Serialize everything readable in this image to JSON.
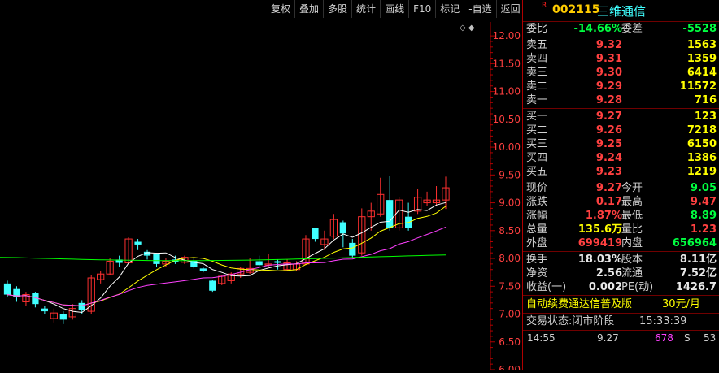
{
  "toolbar": [
    "复权",
    "叠加",
    "多股",
    "统计",
    "画线",
    "F10",
    "标记",
    "-自选",
    "返回"
  ],
  "chart": {
    "y_ticks": [
      "12.00",
      "11.50",
      "11.00",
      "10.50",
      "10.00",
      "9.50",
      "9.00",
      "8.50",
      "8.00",
      "7.50",
      "7.00",
      "6.50",
      "6.00"
    ],
    "toggle_icon": "◇ ◆",
    "candle_up_color": "#ff3030",
    "candle_down_color": "#40ffff",
    "ma_colors": [
      "#ffffff",
      "#ffff00",
      "#ff40ff",
      "#00ff00"
    ]
  },
  "chart_data": {
    "type": "candlestick",
    "ylim": [
      6.0,
      12.25
    ],
    "ma_periods": [
      5,
      10,
      20,
      60
    ],
    "candles": [
      {
        "o": 7.55,
        "c": 7.35,
        "h": 7.6,
        "l": 7.3
      },
      {
        "o": 7.45,
        "c": 7.3,
        "h": 7.5,
        "l": 7.22
      },
      {
        "o": 7.22,
        "c": 7.35,
        "h": 7.4,
        "l": 7.15
      },
      {
        "o": 7.38,
        "c": 7.18,
        "h": 7.4,
        "l": 7.12
      },
      {
        "o": 7.1,
        "c": 7.05,
        "h": 7.15,
        "l": 7.0
      },
      {
        "o": 6.92,
        "c": 7.02,
        "h": 7.1,
        "l": 6.85
      },
      {
        "o": 7.0,
        "c": 6.9,
        "h": 7.05,
        "l": 6.82
      },
      {
        "o": 6.95,
        "c": 7.1,
        "h": 7.18,
        "l": 6.9
      },
      {
        "o": 7.2,
        "c": 7.08,
        "h": 7.25,
        "l": 7.0
      },
      {
        "o": 7.05,
        "c": 7.65,
        "h": 7.7,
        "l": 7.0
      },
      {
        "o": 7.62,
        "c": 7.72,
        "h": 7.78,
        "l": 7.55
      },
      {
        "o": 7.72,
        "c": 7.95,
        "h": 8.0,
        "l": 7.7
      },
      {
        "o": 7.98,
        "c": 7.92,
        "h": 8.05,
        "l": 7.85
      },
      {
        "o": 7.92,
        "c": 8.35,
        "h": 8.38,
        "l": 7.9
      },
      {
        "o": 8.3,
        "c": 8.25,
        "h": 8.35,
        "l": 8.15
      },
      {
        "o": 8.12,
        "c": 8.05,
        "h": 8.15,
        "l": 7.98
      },
      {
        "o": 8.08,
        "c": 7.9,
        "h": 8.1,
        "l": 7.85
      },
      {
        "o": 7.9,
        "c": 7.95,
        "h": 8.0,
        "l": 7.85
      },
      {
        "o": 7.98,
        "c": 7.93,
        "h": 8.05,
        "l": 7.9
      },
      {
        "o": 7.93,
        "c": 8.02,
        "h": 8.05,
        "l": 7.9
      },
      {
        "o": 7.96,
        "c": 7.85,
        "h": 8.0,
        "l": 7.82
      },
      {
        "o": 7.82,
        "c": 7.78,
        "h": 7.85,
        "l": 7.75
      },
      {
        "o": 7.6,
        "c": 7.42,
        "h": 7.62,
        "l": 7.4
      },
      {
        "o": 7.55,
        "c": 7.68,
        "h": 7.7,
        "l": 7.52
      },
      {
        "o": 7.6,
        "c": 7.72,
        "h": 7.75,
        "l": 7.55
      },
      {
        "o": 7.72,
        "c": 7.82,
        "h": 7.85,
        "l": 7.65
      },
      {
        "o": 7.75,
        "c": 7.82,
        "h": 8.0,
        "l": 7.72
      },
      {
        "o": 7.95,
        "c": 7.88,
        "h": 8.05,
        "l": 7.85
      },
      {
        "o": 7.88,
        "c": 7.9,
        "h": 8.08,
        "l": 7.85
      },
      {
        "o": 7.95,
        "c": 7.92,
        "h": 7.98,
        "l": 7.8
      },
      {
        "o": 7.8,
        "c": 7.92,
        "h": 7.98,
        "l": 7.78
      },
      {
        "o": 7.8,
        "c": 7.9,
        "h": 7.95,
        "l": 7.78
      },
      {
        "o": 7.9,
        "c": 8.35,
        "h": 8.42,
        "l": 7.88
      },
      {
        "o": 8.55,
        "c": 8.35,
        "h": 8.55,
        "l": 8.3
      },
      {
        "o": 8.25,
        "c": 8.35,
        "h": 8.5,
        "l": 8.15
      },
      {
        "o": 8.4,
        "c": 8.7,
        "h": 8.8,
        "l": 8.35
      },
      {
        "o": 8.65,
        "c": 8.45,
        "h": 8.68,
        "l": 8.2
      },
      {
        "o": 8.28,
        "c": 8.05,
        "h": 8.35,
        "l": 8.0
      },
      {
        "o": 8.1,
        "c": 8.75,
        "h": 8.9,
        "l": 8.05
      },
      {
        "o": 8.75,
        "c": 8.85,
        "h": 9.0,
        "l": 8.5
      },
      {
        "o": 8.8,
        "c": 9.15,
        "h": 9.45,
        "l": 8.75
      },
      {
        "o": 9.05,
        "c": 8.55,
        "h": 9.48,
        "l": 8.5
      },
      {
        "o": 8.55,
        "c": 9.05,
        "h": 9.1,
        "l": 8.5
      },
      {
        "o": 8.75,
        "c": 8.55,
        "h": 9.0,
        "l": 8.5
      },
      {
        "o": 8.85,
        "c": 9.1,
        "h": 9.25,
        "l": 8.8
      },
      {
        "o": 9.0,
        "c": 9.05,
        "h": 9.2,
        "l": 8.95
      },
      {
        "o": 9.0,
        "c": 9.05,
        "h": 9.3,
        "l": 8.95
      },
      {
        "o": 9.05,
        "c": 9.27,
        "h": 9.47,
        "l": 8.89
      }
    ]
  },
  "quote": {
    "rmark": "R",
    "code": "002115",
    "name": "三维通信",
    "wei_label": "委比",
    "wei_value": "-14.66%",
    "weicha_label": "委差",
    "weicha_value": "-5528",
    "sell": [
      {
        "label": "卖五",
        "price": "9.32",
        "vol": "1563"
      },
      {
        "label": "卖四",
        "price": "9.31",
        "vol": "1359"
      },
      {
        "label": "卖三",
        "price": "9.30",
        "vol": "6414"
      },
      {
        "label": "卖二",
        "price": "9.29",
        "vol": "11572"
      },
      {
        "label": "卖一",
        "price": "9.28",
        "vol": "716"
      }
    ],
    "buy": [
      {
        "label": "买一",
        "price": "9.27",
        "vol": "123"
      },
      {
        "label": "买二",
        "price": "9.26",
        "vol": "7218"
      },
      {
        "label": "买三",
        "price": "9.25",
        "vol": "6150"
      },
      {
        "label": "买四",
        "price": "9.24",
        "vol": "1386"
      },
      {
        "label": "买五",
        "price": "9.23",
        "vol": "1219"
      }
    ],
    "stats": [
      {
        "l1": "现价",
        "v1": "9.27",
        "c1": "red",
        "l2": "今开",
        "v2": "9.05",
        "c2": "green"
      },
      {
        "l1": "涨跌",
        "v1": "0.17",
        "c1": "red",
        "l2": "最高",
        "v2": "9.47",
        "c2": "red"
      },
      {
        "l1": "涨幅",
        "v1": "1.87%",
        "c1": "red",
        "l2": "最低",
        "v2": "8.89",
        "c2": "green"
      },
      {
        "l1": "总量",
        "v1": "135.6万",
        "c1": "yellow",
        "l2": "量比",
        "v2": "1.23",
        "c2": "red"
      },
      {
        "l1": "外盘",
        "v1": "699419",
        "c1": "red",
        "l2": "内盘",
        "v2": "656964",
        "c2": "green"
      }
    ],
    "fund": [
      {
        "l1": "换手",
        "v1": "18.03%",
        "l2": "股本",
        "v2": "8.11亿"
      },
      {
        "l1": "净资",
        "v1": "2.56",
        "l2": "流通",
        "v2": "7.52亿"
      },
      {
        "l1": "收益(一)",
        "v1": "0.002",
        "l2": "PE(动)",
        "v2": "1426.7"
      }
    ],
    "sub_text": "自动续费通达信普及版",
    "sub_price": "30元/月",
    "status_label": "交易状态:",
    "status_value": "闭市阶段",
    "status_time": "15:33:39",
    "tick": {
      "time": "14:55",
      "price": "9.27",
      "vol": "678",
      "side": "S",
      "num": "53"
    }
  }
}
